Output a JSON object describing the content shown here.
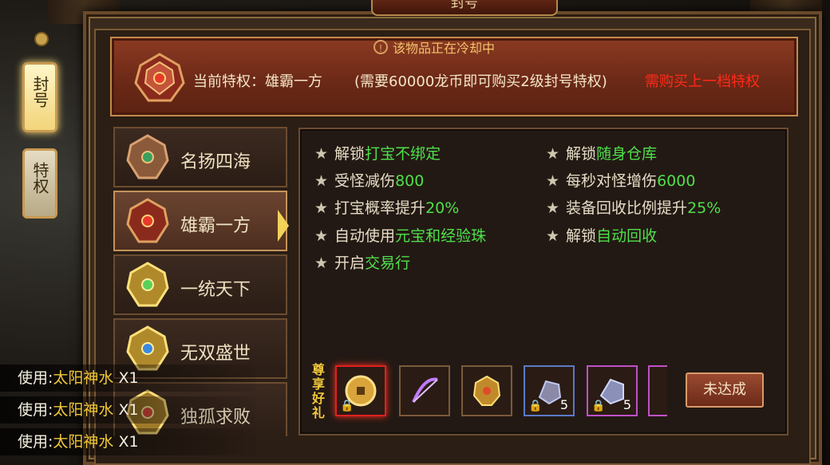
{
  "window": {
    "title": "封号"
  },
  "side_tabs": [
    {
      "label": "封号"
    },
    {
      "label": "特权"
    }
  ],
  "banner": {
    "cooldown_text": "该物品正在冷却中",
    "current_label": "当前特权：雄霸一方",
    "upgrade_hint": "(需要60000龙币即可购买2级封号特权)",
    "need_prev": "需购买上一档特权"
  },
  "titles": [
    {
      "label": "名扬四海",
      "selected": false
    },
    {
      "label": "雄霸一方",
      "selected": true
    },
    {
      "label": "一统天下",
      "selected": false
    },
    {
      "label": "无双盛世",
      "selected": false
    },
    {
      "label": "独孤求败",
      "selected": false
    }
  ],
  "perks_left": [
    {
      "pre": "解锁",
      "hl": "打宝不绑定"
    },
    {
      "pre": "受怪减伤",
      "hl": "800"
    },
    {
      "pre": "打宝概率提升",
      "hl": "20%"
    },
    {
      "pre": "自动使用",
      "hl": "元宝和经验珠"
    },
    {
      "pre": "开启",
      "hl": "交易行"
    }
  ],
  "perks_right": [
    {
      "pre": "解锁",
      "hl": "随身仓库"
    },
    {
      "pre": "每秒对怪增伤",
      "hl": "6000"
    },
    {
      "pre": "装备回收比例提升",
      "hl": "25%"
    },
    {
      "pre": "解锁",
      "hl": "自动回收"
    }
  ],
  "rewards": {
    "label": "尊享好礼",
    "items": [
      {
        "icon": "gold-coin-icon",
        "border": "#e02020",
        "count": ""
      },
      {
        "icon": "purple-bow-icon",
        "border": "#a0603a",
        "count": ""
      },
      {
        "icon": "golden-armor-icon",
        "border": "#a0603a",
        "count": ""
      },
      {
        "icon": "blue-ore-icon",
        "border": "#5a7ac8",
        "count": "5"
      },
      {
        "icon": "purple-ore-icon",
        "border": "#c050c8",
        "count": "5"
      }
    ],
    "button_label": "未达成"
  },
  "chat": [
    {
      "prefix": "使用:",
      "item": "太阳神水",
      "qty": " X1"
    },
    {
      "prefix": "使用:",
      "item": "太阳神水",
      "qty": " X1"
    },
    {
      "prefix": "使用:",
      "item": "太阳神水",
      "qty": " X1"
    }
  ],
  "colors": {
    "highlight_green": "#4ee04a",
    "warning_red": "#ff2a1a",
    "cooldown_gold": "#f2c36a"
  }
}
